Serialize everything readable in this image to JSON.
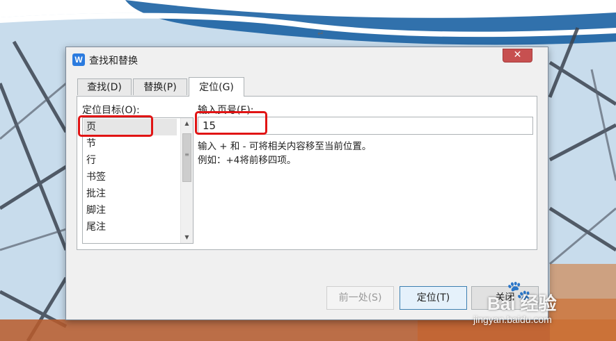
{
  "document": {
    "paragraph_mark": "↵"
  },
  "dialog": {
    "app_icon_letter": "W",
    "title": "查找和替换",
    "close_symbol": "✕",
    "tabs": [
      {
        "label": "查找(D)",
        "active": false
      },
      {
        "label": "替换(P)",
        "active": false
      },
      {
        "label": "定位(G)",
        "active": true
      }
    ],
    "target": {
      "label": "定位目标(O):",
      "items": [
        "页",
        "节",
        "行",
        "书签",
        "批注",
        "脚注",
        "尾注"
      ],
      "selected": "页"
    },
    "page_input": {
      "label": "输入页号(E):",
      "value": "15"
    },
    "hints": [
      "输入 + 和 - 可将相关内容移至当前位置。",
      "例如：+4将前移四项。"
    ],
    "buttons": {
      "prev": "前一处(S)",
      "goto": "定位(T)",
      "close": "关闭"
    }
  },
  "watermark": {
    "brand": "Bai 经验",
    "url": "jingyan.baidu.com"
  },
  "colors": {
    "highlight": "#e11414",
    "accent": "#2b7bdf",
    "close_button": "#c75050"
  }
}
